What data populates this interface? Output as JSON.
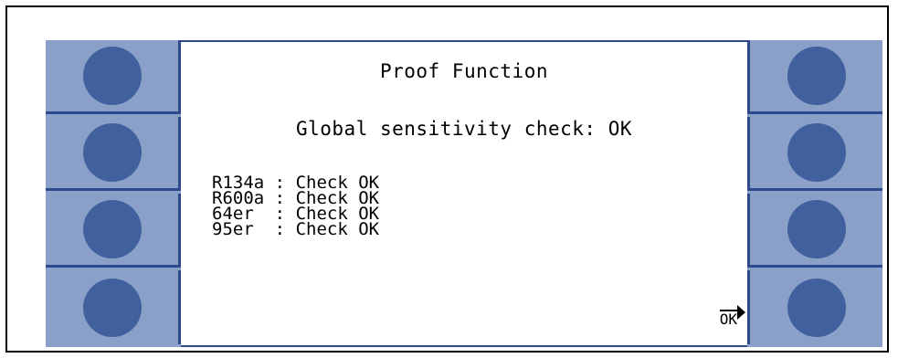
{
  "screen": {
    "title": "Proof Function",
    "global_check": "Global sensitivity check: OK",
    "results": [
      {
        "gas": "R134a",
        "sep": ":",
        "status": "Check OK"
      },
      {
        "gas": "R600a",
        "sep": ":",
        "status": "Check OK"
      },
      {
        "gas": "64er ",
        "sep": ":",
        "status": "Check OK"
      },
      {
        "gas": "95er ",
        "sep": ":",
        "status": "Check OK"
      }
    ],
    "softkey_label": "OK"
  },
  "colors": {
    "panel": "#8aa0c8",
    "button": "#40619e",
    "divider": "#2c4a8c"
  },
  "icons": {
    "softkey_arrow": "arrow-right-icon",
    "panel_button": "circle-button-icon"
  }
}
